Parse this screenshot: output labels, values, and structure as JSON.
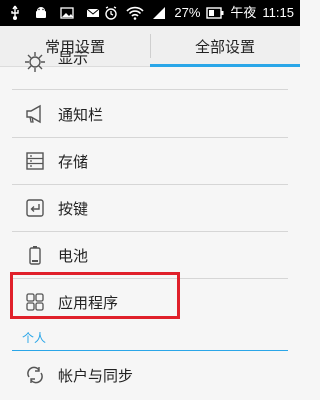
{
  "status_bar": {
    "battery_percent": "27%",
    "time_period": "午夜",
    "time": "11:15",
    "icons": [
      "usb-icon",
      "android-debug-icon",
      "image-icon",
      "mail-icon",
      "alarm-icon",
      "wifi-icon",
      "signal-icon",
      "battery-icon"
    ]
  },
  "tabs": [
    {
      "label": "常用设置",
      "active": false
    },
    {
      "label": "全部设置",
      "active": true
    }
  ],
  "accent_color": "#2aa6e8",
  "highlight_color": "#e0202a",
  "items": [
    {
      "label": "显示",
      "icon": "display-icon"
    },
    {
      "label": "通知栏",
      "icon": "megaphone-icon"
    },
    {
      "label": "存储",
      "icon": "storage-icon"
    },
    {
      "label": "按键",
      "icon": "keys-icon"
    },
    {
      "label": "电池",
      "icon": "battery-icon"
    },
    {
      "label": "应用程序",
      "icon": "apps-icon"
    }
  ],
  "section": {
    "label": "个人"
  },
  "personal_items": [
    {
      "label": "帐户与同步",
      "icon": "sync-icon"
    }
  ]
}
